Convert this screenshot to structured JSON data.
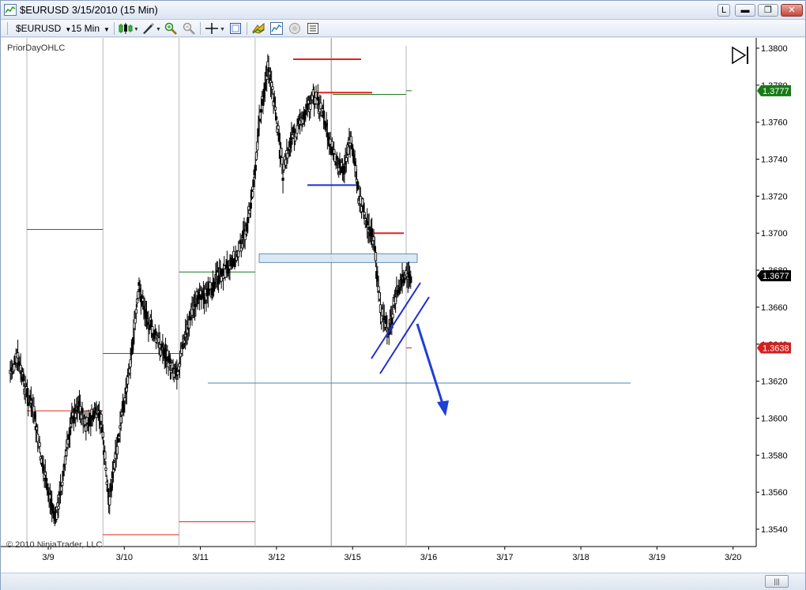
{
  "window": {
    "title": "$EURUSD  3/15/2010 (15 Min)",
    "minimize": "▬",
    "restore": "❐",
    "close": "✕",
    "link_label": "L"
  },
  "toolbar": {
    "instrument": "$EURUSD",
    "interval": "15 Min",
    "icons": [
      "chart-style-icon",
      "drawing-tool-icon",
      "zoom-in-icon",
      "zoom-out-icon",
      "crosshair-icon",
      "data-box-icon",
      "strategies-icon",
      "indicators-icon",
      "properties-icon",
      "chart-properties-icon"
    ]
  },
  "chart": {
    "indicator_label": "PriorDayOHLC",
    "copyright": "© 2010 NinjaTrader, LLC",
    "colors": {
      "prior_high": "#e2231a",
      "prior_low": "#e2231a",
      "prior_open": "#1f7a1f",
      "blue_line": "#1f2fcf",
      "steel_line": "#4a86b8",
      "arrow": "#1f3fd6",
      "last_price_bg": "#000000",
      "green_tag": "#157a15",
      "red_tag": "#d41f1f"
    },
    "price_labels": [
      "1.3800",
      "1.3780",
      "1.3760",
      "1.3740",
      "1.3720",
      "1.3700",
      "1.3680",
      "1.3660",
      "1.3640",
      "1.3620",
      "1.3600",
      "1.3580",
      "1.3560",
      "1.3540"
    ],
    "date_labels": [
      "3/9",
      "3/10",
      "3/11",
      "3/12",
      "3/15",
      "3/16",
      "3/17",
      "3/18",
      "3/19",
      "3/20"
    ],
    "tags": {
      "green": "1.3777",
      "last": "1.3677",
      "red": "1.3638"
    }
  },
  "chart_data": {
    "type": "candlestick",
    "instrument": "$EURUSD",
    "interval": "15 Min",
    "y_range": [
      1.3535,
      1.3805
    ],
    "x_categories": [
      "3/9",
      "3/10",
      "3/11",
      "3/12",
      "3/15",
      "3/16",
      "3/17",
      "3/18",
      "3/19",
      "3/20"
    ],
    "price_path": [
      {
        "date": "3/9",
        "price": 1.3625
      },
      {
        "date": "3/9",
        "price": 1.3632
      },
      {
        "date": "3/9",
        "price": 1.3615
      },
      {
        "date": "3/9",
        "price": 1.3605
      },
      {
        "date": "3/9",
        "price": 1.358
      },
      {
        "date": "3/9",
        "price": 1.356
      },
      {
        "date": "3/9",
        "price": 1.3545
      },
      {
        "date": "3/9",
        "price": 1.357
      },
      {
        "date": "3/9",
        "price": 1.3598
      },
      {
        "date": "3/10",
        "price": 1.3608
      },
      {
        "date": "3/10",
        "price": 1.3595
      },
      {
        "date": "3/10",
        "price": 1.3602
      },
      {
        "date": "3/10",
        "price": 1.36
      },
      {
        "date": "3/10",
        "price": 1.3555
      },
      {
        "date": "3/10",
        "price": 1.358
      },
      {
        "date": "3/10",
        "price": 1.3608
      },
      {
        "date": "3/10",
        "price": 1.3635
      },
      {
        "date": "3/10",
        "price": 1.367
      },
      {
        "date": "3/10",
        "price": 1.3655
      },
      {
        "date": "3/11",
        "price": 1.3645
      },
      {
        "date": "3/11",
        "price": 1.3638
      },
      {
        "date": "3/11",
        "price": 1.363
      },
      {
        "date": "3/11",
        "price": 1.3625
      },
      {
        "date": "3/11",
        "price": 1.3642
      },
      {
        "date": "3/11",
        "price": 1.3658
      },
      {
        "date": "3/11",
        "price": 1.3668
      },
      {
        "date": "3/11",
        "price": 1.3665
      },
      {
        "date": "3/11",
        "price": 1.3675
      },
      {
        "date": "3/11",
        "price": 1.3678
      },
      {
        "date": "3/12",
        "price": 1.3684
      },
      {
        "date": "3/12",
        "price": 1.3688
      },
      {
        "date": "3/12",
        "price": 1.37
      },
      {
        "date": "3/12",
        "price": 1.3722
      },
      {
        "date": "3/12",
        "price": 1.3765
      },
      {
        "date": "3/12",
        "price": 1.3788
      },
      {
        "date": "3/12",
        "price": 1.3768
      },
      {
        "date": "3/12",
        "price": 1.3732
      },
      {
        "date": "3/12",
        "price": 1.375
      },
      {
        "date": "3/12",
        "price": 1.3758
      },
      {
        "date": "3/12",
        "price": 1.3765
      },
      {
        "date": "3/15",
        "price": 1.3775
      },
      {
        "date": "3/15",
        "price": 1.3768
      },
      {
        "date": "3/15",
        "price": 1.3752
      },
      {
        "date": "3/15",
        "price": 1.374
      },
      {
        "date": "3/15",
        "price": 1.3735
      },
      {
        "date": "3/15",
        "price": 1.3752
      },
      {
        "date": "3/15",
        "price": 1.372
      },
      {
        "date": "3/15",
        "price": 1.3708
      },
      {
        "date": "3/15",
        "price": 1.3695
      },
      {
        "date": "3/15",
        "price": 1.3655
      },
      {
        "date": "3/15",
        "price": 1.3648
      },
      {
        "date": "3/15",
        "price": 1.3668
      },
      {
        "date": "3/15",
        "price": 1.3675
      },
      {
        "date": "3/15",
        "price": 1.3677
      }
    ],
    "reference_lines": [
      {
        "color": "green",
        "price": 1.3702,
        "from": "3/9",
        "to": "3/10"
      },
      {
        "color": "red",
        "price": 1.3604,
        "from": "3/9",
        "to": "3/10"
      },
      {
        "color": "green",
        "price": 1.3635,
        "from": "3/10",
        "to": "3/11"
      },
      {
        "color": "red",
        "price": 1.3537,
        "from": "3/10",
        "to": "3/11"
      },
      {
        "color": "green",
        "price": 1.3679,
        "from": "3/11",
        "to": "3/12"
      },
      {
        "color": "red",
        "price": 1.3544,
        "from": "3/11",
        "to": "3/12"
      },
      {
        "color": "red",
        "price": 1.3794,
        "from": "3/12",
        "to": "3/15"
      },
      {
        "color": "red",
        "price": 1.3776,
        "from": "3/12",
        "to": "3/15"
      },
      {
        "color": "blue",
        "price": 1.3726,
        "from": "3/12",
        "to": "3/15"
      },
      {
        "color": "red",
        "price": 1.37,
        "from": "3/15",
        "to": "3/16"
      },
      {
        "color": "steelblue",
        "price": 1.3619,
        "from": "3/11",
        "to": "3/18"
      }
    ],
    "highlight_zone": [
      1.3685,
      1.3688
    ],
    "grid": false
  }
}
